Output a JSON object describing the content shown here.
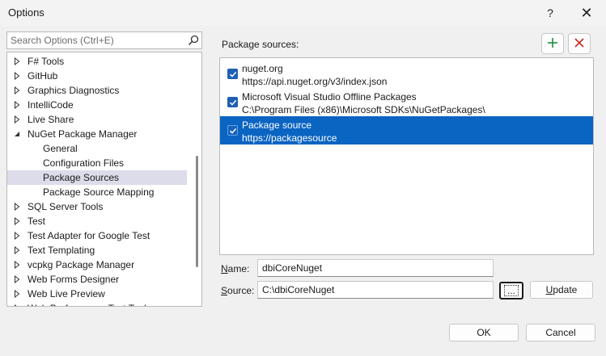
{
  "window": {
    "title": "Options",
    "help_glyph": "?",
    "close_glyph": "✕"
  },
  "search": {
    "placeholder": "Search Options (Ctrl+E)",
    "icon": "search-icon"
  },
  "tree": {
    "items": [
      {
        "label": "F# Tools",
        "level": 0,
        "expander": "collapsed"
      },
      {
        "label": "GitHub",
        "level": 0,
        "expander": "collapsed"
      },
      {
        "label": "Graphics Diagnostics",
        "level": 0,
        "expander": "collapsed"
      },
      {
        "label": "IntelliCode",
        "level": 0,
        "expander": "collapsed"
      },
      {
        "label": "Live Share",
        "level": 0,
        "expander": "collapsed"
      },
      {
        "label": "NuGet Package Manager",
        "level": 0,
        "expander": "expanded"
      },
      {
        "label": "General",
        "level": 1,
        "expander": "none"
      },
      {
        "label": "Configuration Files",
        "level": 1,
        "expander": "none"
      },
      {
        "label": "Package Sources",
        "level": 1,
        "expander": "none",
        "selected": true
      },
      {
        "label": "Package Source Mapping",
        "level": 1,
        "expander": "none"
      },
      {
        "label": "SQL Server Tools",
        "level": 0,
        "expander": "collapsed"
      },
      {
        "label": "Test",
        "level": 0,
        "expander": "collapsed"
      },
      {
        "label": "Test Adapter for Google Test",
        "level": 0,
        "expander": "collapsed"
      },
      {
        "label": "Text Templating",
        "level": 0,
        "expander": "collapsed"
      },
      {
        "label": "vcpkg Package Manager",
        "level": 0,
        "expander": "collapsed"
      },
      {
        "label": "Web Forms Designer",
        "level": 0,
        "expander": "collapsed"
      },
      {
        "label": "Web Live Preview",
        "level": 0,
        "expander": "collapsed"
      },
      {
        "label": "Web Performance Test Tools",
        "level": 0,
        "expander": "collapsed"
      }
    ]
  },
  "package_sources": {
    "heading": "Package sources:",
    "add_icon": "plus-icon",
    "remove_icon": "close-icon",
    "add_color": "#1e8f3c",
    "remove_color": "#c42b1c",
    "items": [
      {
        "name": "nuget.org",
        "url": "https://api.nuget.org/v3/index.json",
        "checked": true,
        "selected": false
      },
      {
        "name": "Microsoft Visual Studio Offline Packages",
        "url": "C:\\Program Files (x86)\\Microsoft SDKs\\NuGetPackages\\",
        "checked": true,
        "selected": false
      },
      {
        "name": "Package source",
        "url": "https://packagesource",
        "checked": true,
        "selected": true
      }
    ]
  },
  "form": {
    "name_label_prefix": "N",
    "name_label_rest": "ame:",
    "name_value": "dbiCoreNuget",
    "source_label_prefix": "S",
    "source_label_rest": "ource:",
    "source_value": "C:\\dbiCoreNuget",
    "browse_label": "...",
    "update_label_prefix": "U",
    "update_label_rest": "pdate"
  },
  "footer": {
    "ok_label": "OK",
    "cancel_label": "Cancel"
  },
  "colors": {
    "selection": "#0a64c2",
    "tree_selection": "#dcdcea",
    "checkbox": "#1f5fb4"
  }
}
